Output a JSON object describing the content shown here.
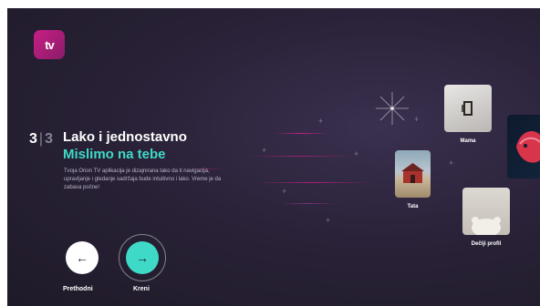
{
  "app": {
    "logo_icon": "orion-tv-logo",
    "logo_text": "tv"
  },
  "onboarding": {
    "step_current": "3",
    "step_separator": "|",
    "step_total": "3",
    "title": "Lako i jednostavno",
    "subtitle": "Mislimo na tebe",
    "description": "Tvoja Orion TV aplikacija je dizajnirana tako da ti navigacija, upravljanje i gledanje sadržaja bude intuitivno i lako. Vreme je da zabava počne!"
  },
  "navigation": {
    "prev": {
      "icon": "arrow-left-icon",
      "glyph": "←",
      "label": "Prethodni"
    },
    "next": {
      "icon": "arrow-right-icon",
      "glyph": "→",
      "label": "Kreni"
    }
  },
  "profiles": [
    {
      "label": "Mama",
      "icon": "profile-image"
    },
    {
      "label": "Tata",
      "icon": "profile-image"
    },
    {
      "label": "Dečiji profil",
      "icon": "profile-image"
    }
  ],
  "colors": {
    "accent": "#3fd9c7",
    "brand": "#c81e84",
    "background": "#2a2238"
  }
}
